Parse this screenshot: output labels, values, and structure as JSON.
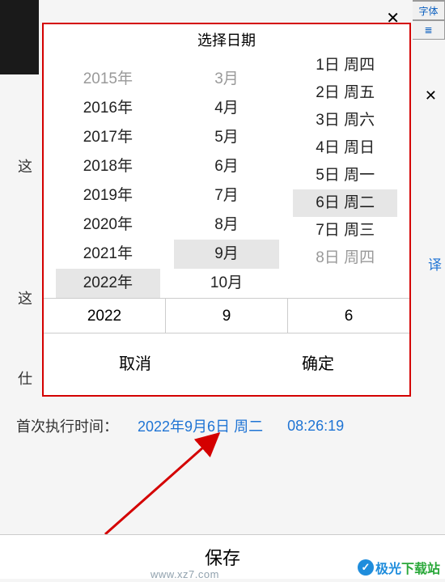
{
  "picker": {
    "title": "选择日期",
    "years": [
      {
        "label": "2015年",
        "selected": false,
        "faded": true
      },
      {
        "label": "2016年",
        "selected": false,
        "faded": false
      },
      {
        "label": "2017年",
        "selected": false,
        "faded": false
      },
      {
        "label": "2018年",
        "selected": false,
        "faded": false
      },
      {
        "label": "2019年",
        "selected": false,
        "faded": false
      },
      {
        "label": "2020年",
        "selected": false,
        "faded": false
      },
      {
        "label": "2021年",
        "selected": false,
        "faded": false
      },
      {
        "label": "2022年",
        "selected": true,
        "faded": false
      }
    ],
    "months": [
      {
        "label": "3月",
        "selected": false,
        "faded": true
      },
      {
        "label": "4月",
        "selected": false,
        "faded": false
      },
      {
        "label": "5月",
        "selected": false,
        "faded": false
      },
      {
        "label": "6月",
        "selected": false,
        "faded": false
      },
      {
        "label": "7月",
        "selected": false,
        "faded": false
      },
      {
        "label": "8月",
        "selected": false,
        "faded": false
      },
      {
        "label": "9月",
        "selected": true,
        "faded": false
      },
      {
        "label": "10月",
        "selected": false,
        "faded": false
      }
    ],
    "days": [
      {
        "label": "1日 周四",
        "selected": false
      },
      {
        "label": "2日 周五",
        "selected": false
      },
      {
        "label": "3日 周六",
        "selected": false
      },
      {
        "label": "4日 周日",
        "selected": false
      },
      {
        "label": "5日 周一",
        "selected": false
      },
      {
        "label": "6日 周二",
        "selected": true
      },
      {
        "label": "7日 周三",
        "selected": false
      },
      {
        "label": "8日 周四",
        "selected": false,
        "faded": true
      }
    ],
    "selected": {
      "year": "2022",
      "month": "9",
      "day": "6"
    },
    "actions": {
      "cancel": "取消",
      "confirm": "确定"
    }
  },
  "side_labels": {
    "l1": "这",
    "l2": "这",
    "l3": "仕"
  },
  "side_link": "译",
  "exec": {
    "label": "首次执行时间：",
    "date": "2022年9月6日 周二",
    "time": "08:26:19"
  },
  "save_label": "保存",
  "toolbar": {
    "font": "字体",
    "align_icon": "≣"
  },
  "watermark": {
    "check": "✓",
    "brand1": "极光",
    "brand2": "下载站"
  },
  "net_addr": "www.xz7.com"
}
